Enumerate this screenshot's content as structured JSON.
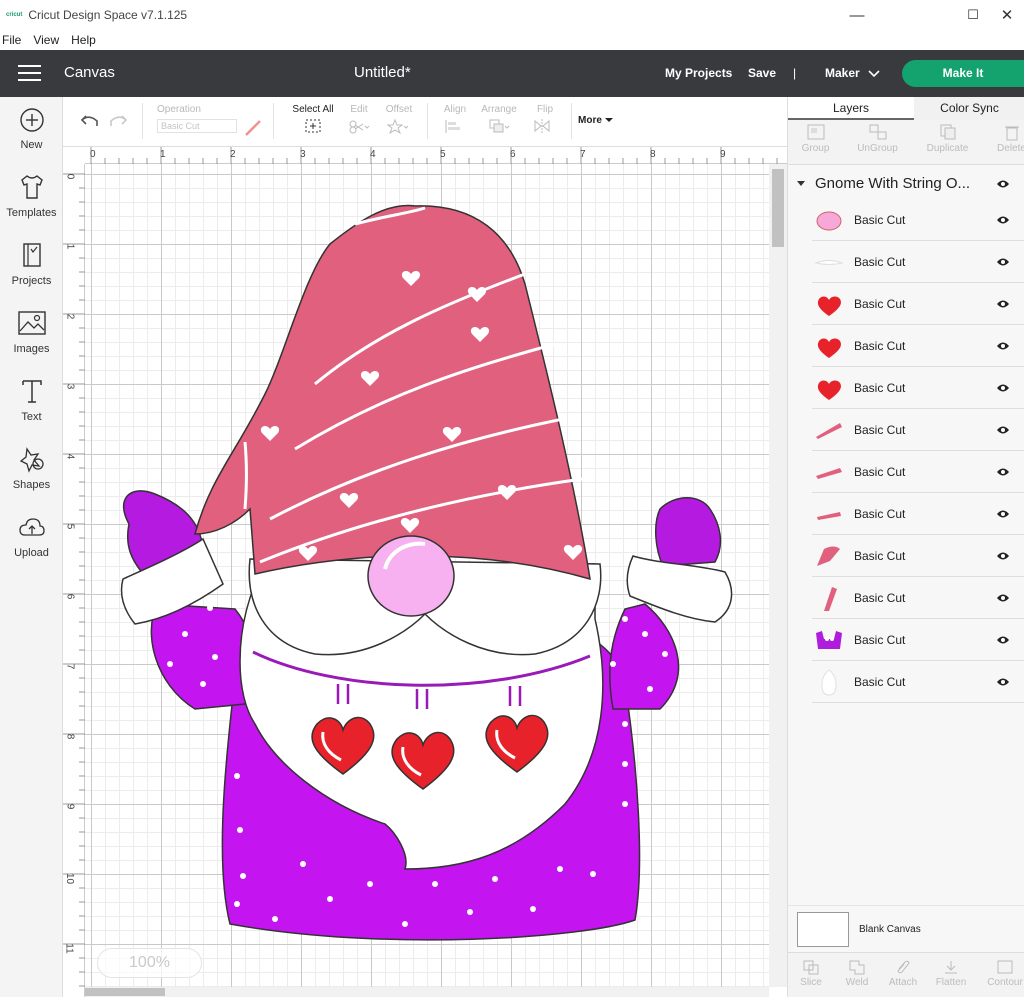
{
  "window": {
    "app_title": "Cricut Design Space  v7.1.125",
    "logo_text": "cricut",
    "minimize": "—",
    "maximize": "☐",
    "close": "✕"
  },
  "menu": {
    "items": [
      "File",
      "View",
      "Help"
    ]
  },
  "header": {
    "canvas_label": "Canvas",
    "doc_title": "Untitled*",
    "my_projects": "My Projects",
    "save": "Save",
    "separator": "|",
    "machine": "Maker",
    "make_it": "Make It"
  },
  "sidebar": {
    "items": [
      {
        "label": "New",
        "icon": "plus-circle-icon"
      },
      {
        "label": "Templates",
        "icon": "tshirt-icon"
      },
      {
        "label": "Projects",
        "icon": "projects-icon"
      },
      {
        "label": "Images",
        "icon": "image-icon"
      },
      {
        "label": "Text",
        "icon": "text-icon"
      },
      {
        "label": "Shapes",
        "icon": "shapes-icon"
      },
      {
        "label": "Upload",
        "icon": "upload-icon"
      }
    ]
  },
  "toolbar": {
    "operation_label": "Operation",
    "operation_value": "Basic Cut",
    "select_all": "Select All",
    "edit": "Edit",
    "offset": "Offset",
    "align": "Align",
    "arrange": "Arrange",
    "flip": "Flip",
    "more": "More"
  },
  "rulers": {
    "top": [
      "0",
      "1",
      "2",
      "3",
      "4",
      "5",
      "6",
      "7",
      "8",
      "9"
    ],
    "left": [
      "0",
      "1",
      "2",
      "3",
      "4",
      "5",
      "6",
      "7",
      "8",
      "9",
      "10",
      "11"
    ]
  },
  "zoom": "100%",
  "panel": {
    "tabs": {
      "layers": "Layers",
      "color_sync": "Color Sync"
    },
    "actions": {
      "group": "Group",
      "ungroup": "UnGroup",
      "duplicate": "Duplicate",
      "delete": "Delete"
    },
    "group_name": "Gnome With String O...",
    "layers": [
      {
        "name": "Basic Cut",
        "swatch": "#f7a8d8"
      },
      {
        "name": "Basic Cut",
        "swatch": "#ffffff"
      },
      {
        "name": "Basic Cut",
        "swatch": "#e8222a"
      },
      {
        "name": "Basic Cut",
        "swatch": "#e8222a"
      },
      {
        "name": "Basic Cut",
        "swatch": "#e8222a"
      },
      {
        "name": "Basic Cut",
        "swatch": "#e0607e"
      },
      {
        "name": "Basic Cut",
        "swatch": "#e0607e"
      },
      {
        "name": "Basic Cut",
        "swatch": "#e0607e"
      },
      {
        "name": "Basic Cut",
        "swatch": "#e0607e"
      },
      {
        "name": "Basic Cut",
        "swatch": "#e0607e"
      },
      {
        "name": "Basic Cut",
        "swatch": "#b01cdc"
      },
      {
        "name": "Basic Cut",
        "swatch": "#ffffff"
      }
    ],
    "blank_canvas": "Blank Canvas",
    "bottom_actions": {
      "slice": "Slice",
      "weld": "Weld",
      "attach": "Attach",
      "flatten": "Flatten",
      "contour": "Contour"
    }
  },
  "colors": {
    "header_bg": "#383a3e",
    "make_it_green": "#14a36e",
    "hat_pink": "#e0607e",
    "sweater_purple": "#c414f0",
    "heart_red": "#e8222a",
    "nose_pink": "#f7b0f0"
  }
}
